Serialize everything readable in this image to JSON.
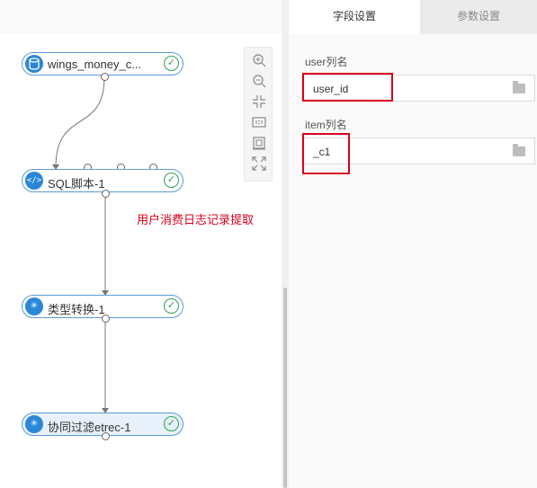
{
  "tabs": {
    "active": "字段设置",
    "inactive": "参数设置"
  },
  "fields": [
    {
      "label": "user列名",
      "value": "user_id"
    },
    {
      "label": "item列名",
      "value": "_c1"
    }
  ],
  "annotation": "用户消费日志记录提取",
  "nodes": [
    {
      "label": "wings_money_c...",
      "icon": "database-icon",
      "status": "success"
    },
    {
      "label": "SQL脚本-1",
      "icon": "code-icon",
      "status": "success"
    },
    {
      "label": "类型转换-1",
      "icon": "transform-icon",
      "status": "success"
    },
    {
      "label": "协同过滤etrec-1",
      "icon": "algorithm-icon",
      "status": "success"
    }
  ],
  "toolbar": [
    "zoom-in-icon",
    "zoom-out-icon",
    "fit-icon",
    "actual-size-icon",
    "grid-icon",
    "fullscreen-icon"
  ],
  "colors": {
    "accent": "#2a87d8",
    "success": "#2ea44f",
    "highlight": "#d9001b",
    "node_border": "#5b9bd5"
  }
}
